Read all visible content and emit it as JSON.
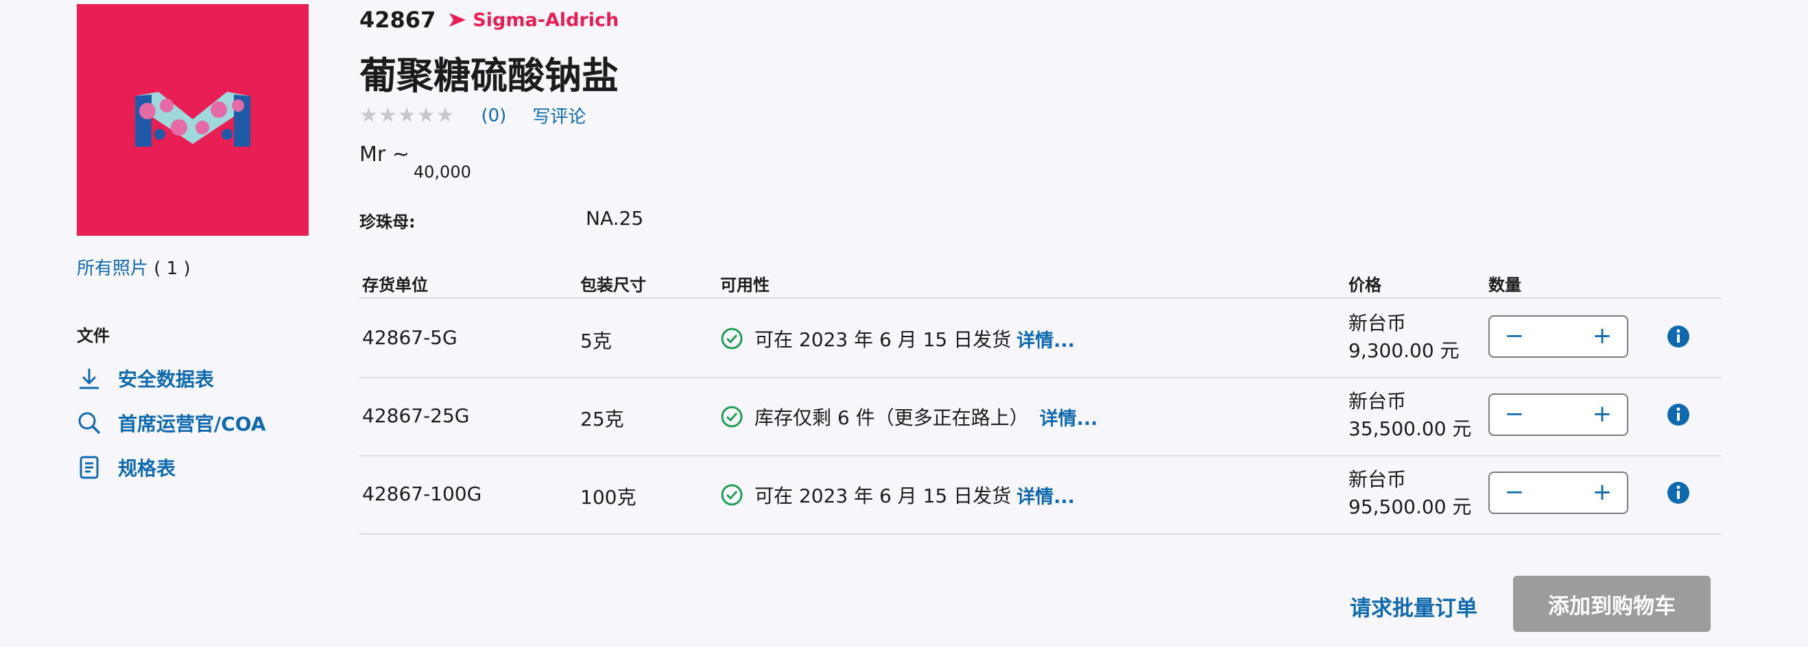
{
  "product": {
    "sku_number": "42867",
    "brand": "Sigma-Aldrich",
    "title": "葡聚糖硫酸钠盐",
    "rating": {
      "stars": "★★★★★",
      "count": "(0)",
      "write_review": "写评论"
    },
    "mr_label": "Mr ~",
    "mr_value": "40,000",
    "spec_label": "珍珠母:",
    "spec_value": "NA.25"
  },
  "gallery": {
    "all_photos_label": "所有照片",
    "all_photos_count": "( 1 )"
  },
  "documents": {
    "title": "文件",
    "items": [
      {
        "label": "安全数据表",
        "icon": "download-icon"
      },
      {
        "label": "首席运营官/COA",
        "icon": "search-icon"
      },
      {
        "label": "规格表",
        "icon": "document-icon"
      }
    ]
  },
  "table": {
    "headers": {
      "sku": "存货单位",
      "pack": "包装尺寸",
      "availability": "可用性",
      "price": "价格",
      "qty": "数量"
    },
    "rows": [
      {
        "sku": "42867-5G",
        "pack": "5克",
        "availability": "可在 2023 年 6 月 15 日发货",
        "details": "详情...",
        "currency": "新台币",
        "price": "9,300.00 元"
      },
      {
        "sku": "42867-25G",
        "pack": "25克",
        "availability": "库存仅剩 6 件（更多正在路上）",
        "details": "详情...",
        "currency": "新台币",
        "price": "35,500.00 元"
      },
      {
        "sku": "42867-100G",
        "pack": "100克",
        "availability": "可在 2023 年 6 月 15 日发货",
        "details": "详情...",
        "currency": "新台币",
        "price": "95,500.00 元"
      }
    ]
  },
  "actions": {
    "bulk_order": "请求批量订单",
    "add_to_cart": "添加到购物车"
  },
  "colors": {
    "brand_pink": "#e91e54",
    "link_blue": "#0f69af",
    "check_green": "#1f9d55",
    "disabled_button": "#9c9c9c"
  }
}
